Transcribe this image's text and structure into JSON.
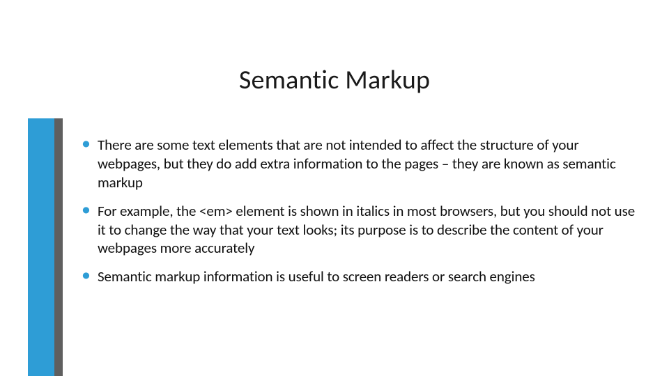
{
  "slide": {
    "title": "Semantic Markup",
    "bullets": [
      "There are some text elements that are not intended to affect the structure of your webpages, but they do add extra information to the pages – they are known as semantic markup",
      "For example, the <em> element is shown in italics in most browsers, but you should not use it to change the way that your text looks; its purpose is to describe the content of your webpages more accurately",
      "Semantic markup information is useful to screen readers or search engines"
    ]
  },
  "colors": {
    "accent": "#2e9dd6",
    "stripe_secondary": "#5f5f5f"
  }
}
